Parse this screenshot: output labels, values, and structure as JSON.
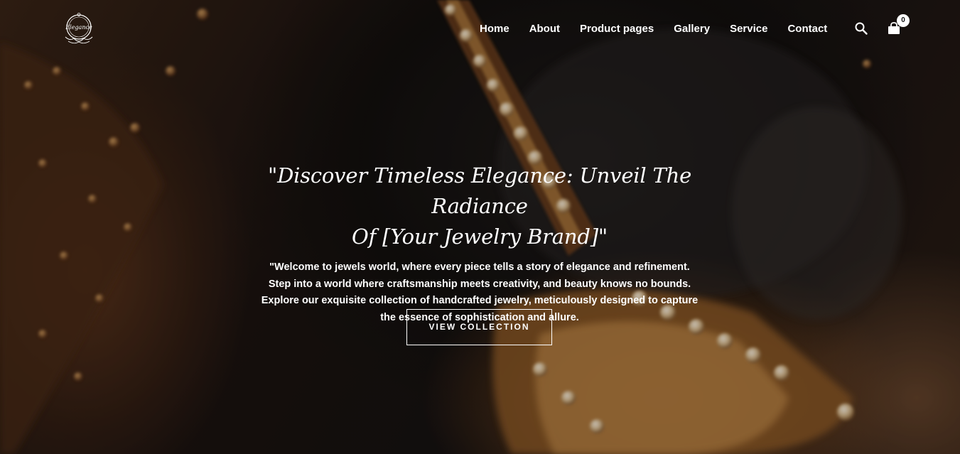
{
  "brand": {
    "logo_icon": "elegance-logo-emblem",
    "logo_text": "Elegance"
  },
  "nav": {
    "items": [
      {
        "label": "Home"
      },
      {
        "label": "About"
      },
      {
        "label": "Product pages"
      },
      {
        "label": "Gallery"
      },
      {
        "label": "Service"
      },
      {
        "label": "Contact"
      }
    ],
    "search_icon": "search-icon",
    "cart_icon": "shopping-bag-icon",
    "cart_count": "0"
  },
  "hero": {
    "headline_line1": "\"Discover Timeless Elegance: Unveil The Radiance",
    "headline_line2": "Of [Your Jewelry Brand]\"",
    "intro_line1": "\"Welcome to jewels world, where every piece tells a story of elegance and refinement.",
    "intro_line2": "Step into a world where craftsmanship meets creativity, and beauty knows no bounds.",
    "intro_line3": "Explore our exquisite collection of handcrafted jewelry, meticulously designed to capture",
    "intro_line4": "the essence of sophistication and allure.",
    "cta_label": "VIEW COLLECTION"
  },
  "colors": {
    "text": "#ffffff",
    "background_dark": "#1a120d",
    "gold": "#c8924a"
  }
}
